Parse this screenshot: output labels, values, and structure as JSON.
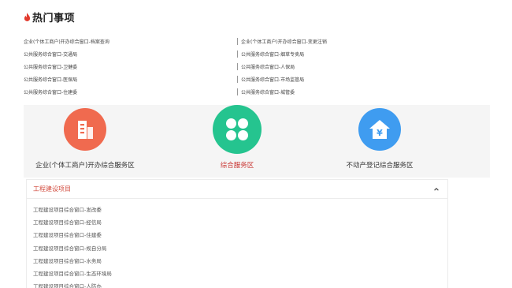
{
  "hot": {
    "title": "热门事项",
    "left": [
      "企业(个体工商户)开办综合窗口-档案查询",
      "公共服务综合窗口-交通局",
      "公共服务综合窗口-卫健委",
      "公共服务综合窗口-医保局",
      "公共服务综合窗口-住建委"
    ],
    "right": [
      "企业(个体工商户)开办综合窗口-变更注销",
      "公共服务综合窗口-烟草专卖局",
      "公共服务综合窗口-人保局",
      "公共服务综合窗口-市场监管局",
      "公共服务综合窗口-城管委"
    ]
  },
  "zones": [
    {
      "label": "企业(个体工商户)开办综合服务区",
      "icon": "building-icon",
      "color": "#f06a4f"
    },
    {
      "label": "综合服务区",
      "icon": "clover-icon",
      "color": "#25c48f"
    },
    {
      "label": "不动产登记综合服务区",
      "icon": "house-yuan-icon",
      "color": "#3f9cf0"
    }
  ],
  "accordion": {
    "title": "工程建设项目",
    "items": [
      "工程建设项目综合窗口-发改委",
      "工程建设项目综合窗口-经信局",
      "工程建设项目综合窗口-住建委",
      "工程建设项目综合窗口-规自分局",
      "工程建设项目综合窗口-水务局",
      "工程建设项目综合窗口-生态环境局",
      "工程建设项目综合窗口-人防办"
    ]
  }
}
